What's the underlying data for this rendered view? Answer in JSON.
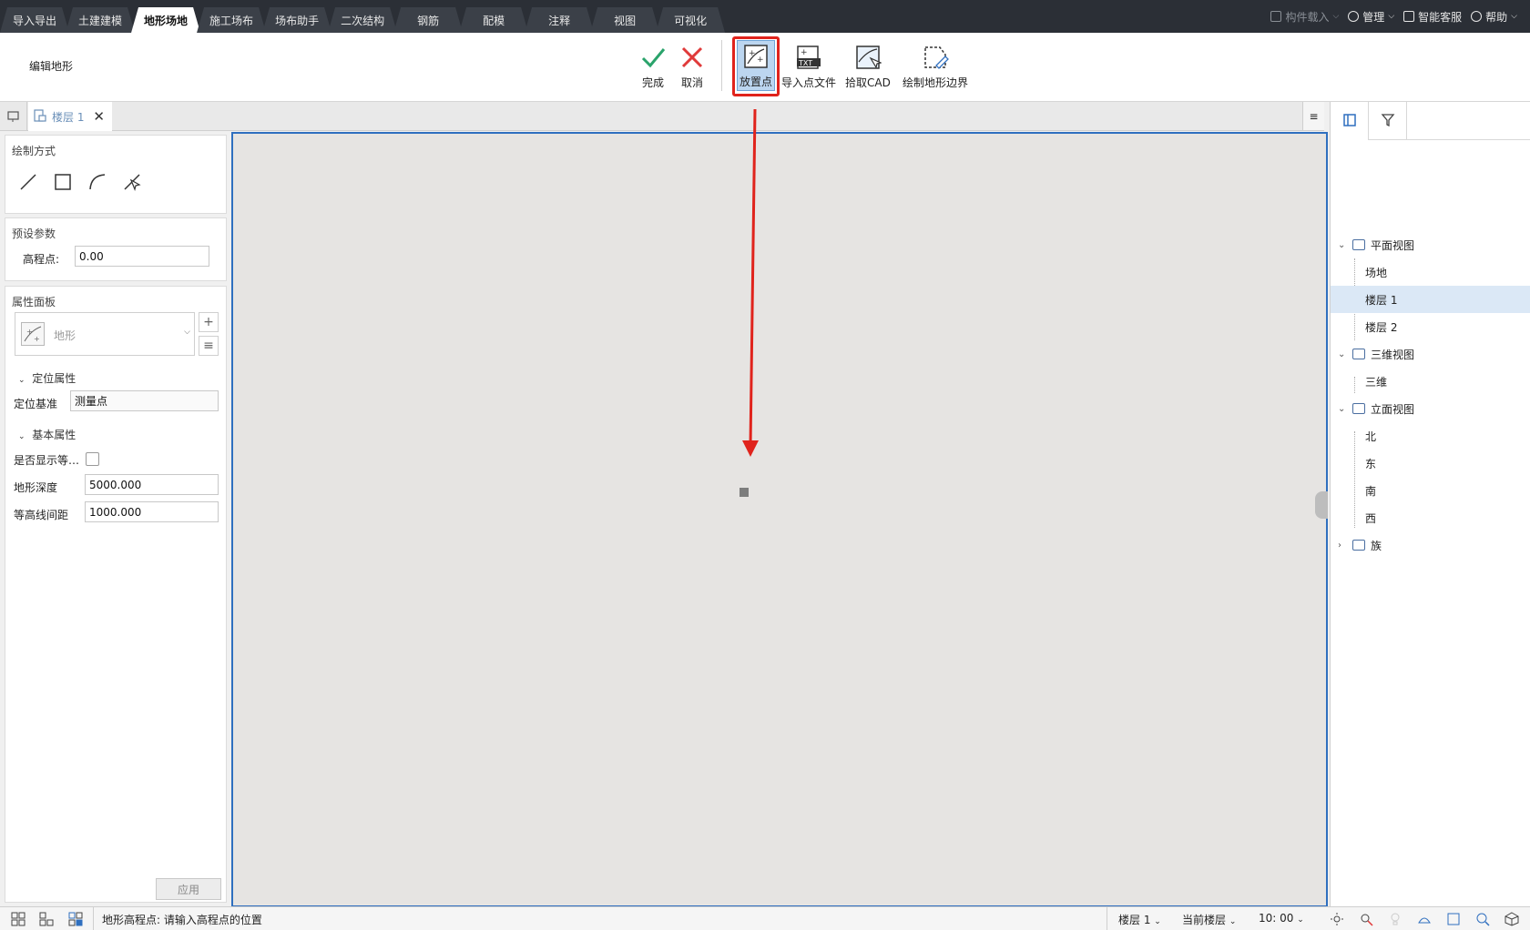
{
  "top_tabs": [
    {
      "label": "导入导出"
    },
    {
      "label": "土建建模"
    },
    {
      "label": "地形场地",
      "active": true
    },
    {
      "label": "施工场布"
    },
    {
      "label": "场布助手"
    },
    {
      "label": "二次结构"
    },
    {
      "label": "钢筋"
    },
    {
      "label": "配模"
    },
    {
      "label": "注释"
    },
    {
      "label": "视图"
    },
    {
      "label": "可视化"
    }
  ],
  "top_right": {
    "component_load": "构件载入",
    "manage": "管理",
    "support": "智能客服",
    "help": "帮助"
  },
  "ribbon": {
    "title": "编辑地形",
    "done": "完成",
    "cancel": "取消",
    "place_point": "放置点",
    "import_point_file": "导入点文件",
    "pick_cad": "拾取CAD",
    "draw_boundary": "绘制地形边界"
  },
  "doc_tab": {
    "label": "楼层 1"
  },
  "left_panel": {
    "draw_mode_title": "绘制方式",
    "preset_title": "预设参数",
    "elevation_label": "高程点:",
    "elevation_value": "0.00",
    "props_title": "属性面板",
    "type_name": "地形",
    "group_positioning": "定位属性",
    "position_base_label": "定位基准",
    "position_base_value": "测量点",
    "group_basic": "基本属性",
    "show_contour_label": "是否显示等…",
    "terrain_depth_label": "地形深度",
    "terrain_depth_value": "5000.000",
    "contour_spacing_label": "等高线间距",
    "contour_spacing_value": "1000.000",
    "apply": "应用"
  },
  "tree": {
    "plan_views": "平面视图",
    "site": "场地",
    "floor1": "楼层 1",
    "floor2": "楼层 2",
    "views_3d": "三维视图",
    "three_d": "三维",
    "elevations": "立面视图",
    "north": "北",
    "east": "东",
    "south": "南",
    "west": "西",
    "family": "族"
  },
  "status": {
    "message": "地形高程点: 请输入高程点的位置",
    "floor": "楼层 1",
    "current_floor": "当前楼层",
    "scale": "10: 00"
  },
  "colors": {
    "accent_blue": "#2f6fbf",
    "highlight_red": "#e0231c",
    "done_green": "#2aa36b",
    "cancel_red": "#e03a3a"
  }
}
